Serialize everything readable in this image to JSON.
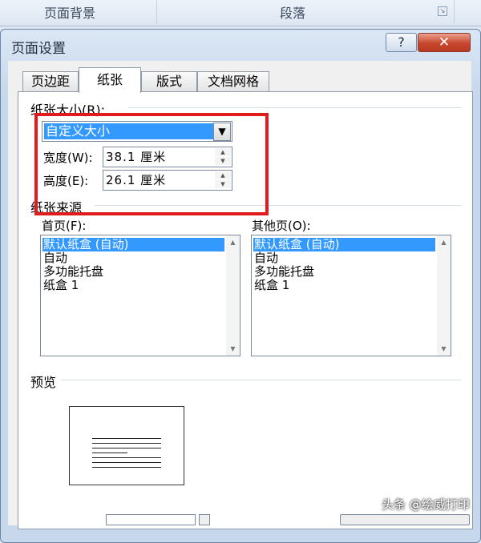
{
  "ribbon": {
    "group1": "页面背景",
    "group2": "段落"
  },
  "dialog": {
    "title": "页面设置",
    "help_label": "?",
    "close_label": "✕"
  },
  "tabs": [
    "页边距",
    "纸张",
    "版式",
    "文档网格"
  ],
  "paper_size": {
    "group_label": "纸张大小(R):",
    "selected": "自定义大小",
    "width_label": "宽度(W):",
    "width_value": "38.1 厘米",
    "height_label": "高度(E):",
    "height_value": "26.1 厘米"
  },
  "paper_source": {
    "group_label": "纸张来源",
    "first_page_label": "首页(F):",
    "other_pages_label": "其他页(O):",
    "first_page_items": [
      "默认纸盒 (自动)",
      "自动",
      "多功能托盘",
      "纸盒 1"
    ],
    "other_pages_items": [
      "默认纸盒 (自动)",
      "自动",
      "多功能托盘",
      "纸盒 1"
    ]
  },
  "preview": {
    "label": "预览"
  },
  "watermark": "头条 @绘威打印",
  "colors": {
    "selection": "#3399ff",
    "highlight_box": "#e01b1b",
    "close_button": "#c8462d"
  },
  "icons": {
    "dropdown": "chevron-down-icon",
    "spin_up": "arrow-up-icon",
    "spin_down": "arrow-down-icon"
  }
}
